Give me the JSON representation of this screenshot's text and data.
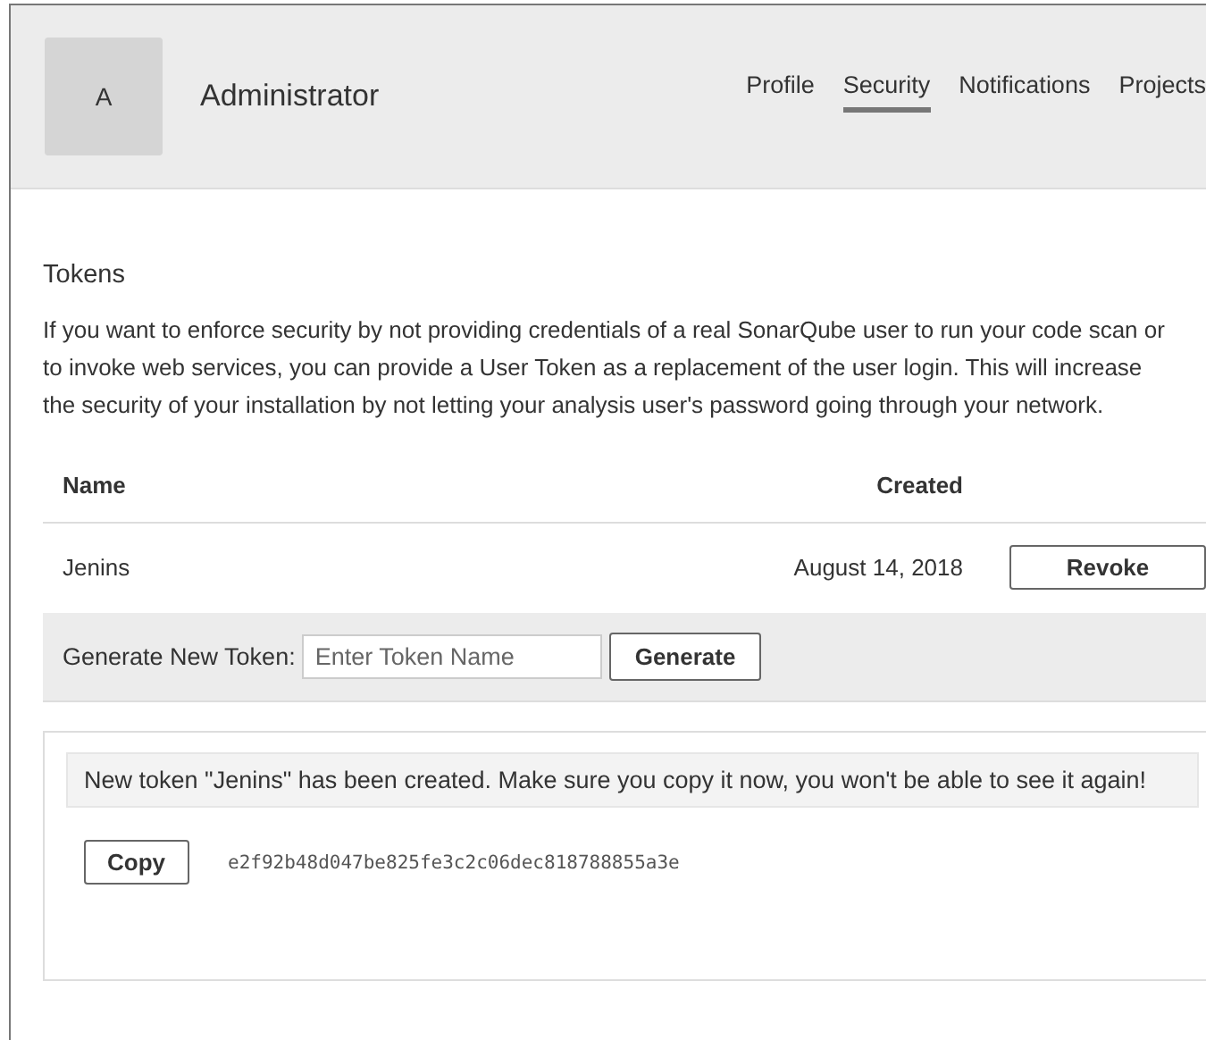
{
  "header": {
    "avatar": "A",
    "user_name": "Administrator"
  },
  "tabs": [
    {
      "label": "Profile",
      "selected": false
    },
    {
      "label": "Security",
      "selected": true
    },
    {
      "label": "Notifications",
      "selected": false
    },
    {
      "label": "Projects",
      "selected": false
    }
  ],
  "tokens": {
    "title": "Tokens",
    "description": "If you want to enforce security by not providing credentials of a real SonarQube user to run your code scan or to invoke web services, you can provide a User Token as a replacement of the user login. This will increase the security of your installation by not letting your analysis user's password going through your network.",
    "table": {
      "columns": [
        "Name",
        "Created"
      ],
      "rows": [
        {
          "name": "Jenins",
          "created": "August 14, 2018",
          "action": "Revoke"
        }
      ]
    },
    "generate": {
      "label": "Generate New Token:",
      "placeholder": "Enter Token Name",
      "button": "Generate"
    },
    "new_token": {
      "message": "New token \"Jenins\" has been created. Make sure you copy it now, you won't be able to see it again!",
      "copy_button": "Copy",
      "token": "e2f92b48d047be825fe3c2c06dec818788855a3e"
    }
  }
}
